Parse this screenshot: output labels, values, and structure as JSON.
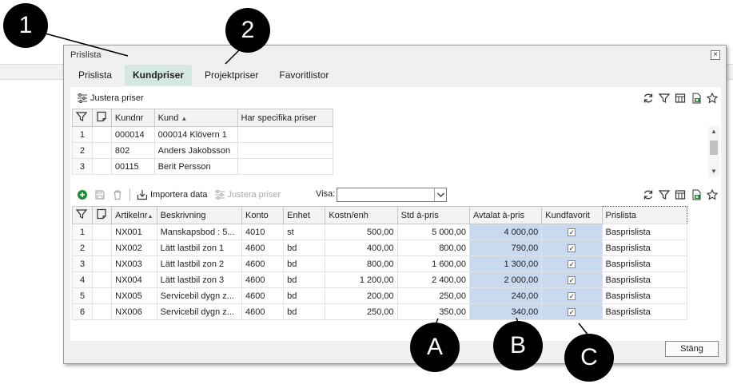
{
  "window": {
    "title": "Prislista"
  },
  "tabs": [
    {
      "label": "Prislista"
    },
    {
      "label": "Kundpriser"
    },
    {
      "label": "Projektpriser"
    },
    {
      "label": "Favoritlistor"
    }
  ],
  "customer_toolbar": {
    "adjust_label": "Justera priser"
  },
  "customer_table": {
    "headers": [
      "Kundnr",
      "Kund",
      "Har specifika priser"
    ],
    "rows": [
      {
        "num": "1",
        "kundnr": "000014",
        "kund": "000014 Klövern 1",
        "specific": ""
      },
      {
        "num": "2",
        "kundnr": "802",
        "kund": "Anders Jakobsson",
        "specific": ""
      },
      {
        "num": "3",
        "kundnr": "00115",
        "kund": "Berit Persson",
        "specific": ""
      }
    ]
  },
  "article_toolbar": {
    "import_label": "Importera data",
    "adjust_label": "Justera priser",
    "visa_label": "Visa:",
    "visa_value": ""
  },
  "article_table": {
    "headers": [
      "Artikelnr",
      "Beskrivning",
      "Konto",
      "Enhet",
      "Kostn/enh",
      "Std à-pris",
      "Avtalat à-pris",
      "Kundfavorit",
      "Prislista"
    ],
    "rows": [
      {
        "num": "1",
        "artnr": "NX001",
        "desc": "Manskapsbod : 5...",
        "konto": "4010",
        "enhet": "st",
        "kostn": "500,00",
        "std": "5 000,00",
        "avtalat": "4 000,00",
        "fav": "✓",
        "prislista": "Basprislista"
      },
      {
        "num": "2",
        "artnr": "NX002",
        "desc": "Lätt lastbil zon 1",
        "konto": "4600",
        "enhet": "bd",
        "kostn": "400,00",
        "std": "800,00",
        "avtalat": "790,00",
        "fav": "✓",
        "prislista": "Basprislista"
      },
      {
        "num": "3",
        "artnr": "NX003",
        "desc": "Lätt lastbil zon 2",
        "konto": "4600",
        "enhet": "bd",
        "kostn": "800,00",
        "std": "1 600,00",
        "avtalat": "1 300,00",
        "fav": "✓",
        "prislista": "Basprislista"
      },
      {
        "num": "4",
        "artnr": "NX004",
        "desc": "Lätt lastbil zon 3",
        "konto": "4600",
        "enhet": "bd",
        "kostn": "1 200,00",
        "std": "2 400,00",
        "avtalat": "2 000,00",
        "fav": "✓",
        "prislista": "Basprislista"
      },
      {
        "num": "5",
        "artnr": "NX005",
        "desc": "Servicebil dygn z...",
        "konto": "4600",
        "enhet": "bd",
        "kostn": "200,00",
        "std": "250,00",
        "avtalat": "240,00",
        "fav": "✓",
        "prislista": "Basprislista"
      },
      {
        "num": "6",
        "artnr": "NX006",
        "desc": "Servicebil dygn z...",
        "konto": "4600",
        "enhet": "bd",
        "kostn": "250,00",
        "std": "350,00",
        "avtalat": "340,00",
        "fav": "✓",
        "prislista": "Basprislista"
      }
    ]
  },
  "footer": {
    "close_label": "Stäng"
  },
  "callouts": [
    "1",
    "2",
    "A",
    "B",
    "C"
  ],
  "colors": {
    "active_tab": "#d5e8df",
    "highlight": "#c9daf0",
    "add_green": "#1e8c3a"
  }
}
